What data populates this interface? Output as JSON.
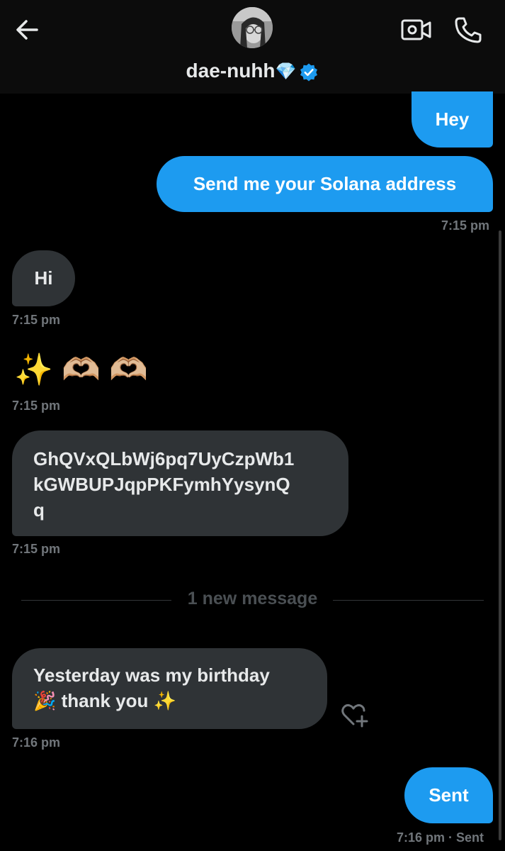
{
  "header": {
    "contact_name": "dae-nuhh",
    "name_emoji": "💎"
  },
  "messages": {
    "m1": {
      "text": "Hey"
    },
    "m2": {
      "text": "Send me your Solana address",
      "time": "7:15 pm"
    },
    "m3": {
      "text": "Hi",
      "time": "7:15 pm"
    },
    "m4": {
      "text": "✨ 🫶🏼 🫶🏼",
      "time": "7:15 pm"
    },
    "m5": {
      "line1": "GhQVxQLbWj6pq7UyCzpWb1",
      "line2": "kGWBUPJqpPKFymhYysynQ",
      "line3": "q",
      "time": "7:15 pm"
    },
    "m6": {
      "line1": "Yesterday was my birthday",
      "line2": "🎉 thank you ✨",
      "time": "7:16 pm"
    },
    "m7": {
      "text": "Sent",
      "time": "7:16 pm · Sent"
    }
  },
  "divider": {
    "label": "1 new message"
  },
  "colors": {
    "accent": "#1d9bf0",
    "incoming_bubble": "#2f3336",
    "timestamp": "#71767b",
    "background": "#000000"
  },
  "icons": [
    "back-arrow-icon",
    "video-call-icon",
    "phone-icon",
    "verified-badge-icon",
    "add-reaction-icon"
  ]
}
